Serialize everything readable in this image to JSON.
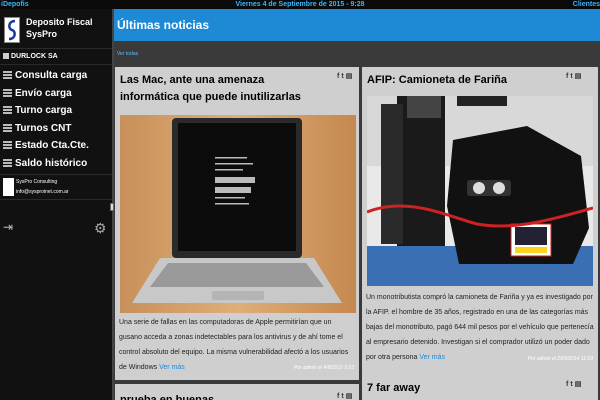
{
  "topbar": {
    "left": "iDepofis",
    "center": "Viernes 4 de Septiembre de 2015 - 9:28",
    "right": "Clientes"
  },
  "brand": {
    "line1": "Deposito Fiscal",
    "line2": "SysPro"
  },
  "company": "DURLOCK SA",
  "menu": [
    {
      "label": "Consulta carga"
    },
    {
      "label": "Envío carga"
    },
    {
      "label": "Turno carga"
    },
    {
      "label": "Turnos CNT"
    },
    {
      "label": "Estado Cta.Cte."
    },
    {
      "label": "Saldo histórico"
    }
  ],
  "consulting": {
    "name": "SysPro Consulting",
    "email": "info@sysproinet.com.ar"
  },
  "icons": {
    "exit": "exit-icon",
    "settings": "gear-icon",
    "share": [
      "facebook-icon",
      "twitter-icon",
      "share-icon"
    ]
  },
  "main": {
    "title": "Últimas noticias",
    "see_all": "Ver todas"
  },
  "articles": [
    {
      "title": "Las Mac, ante una amenaza informática que puede inutilizarlas",
      "body": "Una serie de fallas en las computadoras de Apple permitirían que un gusano acceda a zonas indetectables para los antivirus y de ahí tome el control absoluto del equipo. La misma vulnerabilidad afectó a los usuarios de Windows",
      "more": "Ver más",
      "meta": "Por admin el 4/8/2015 9:23"
    },
    {
      "title": "AFIP: Camioneta de Fariña",
      "body": "Un monotributista compró la camioneta de Fariña y ya es investigado por la AFIP. el hombre de 35 años, registrado en una de las categorías más bajas del monotributo, pagó 644 mil pesos por el vehículo que pertenecía al empresario detenido. Investigan si el comprador utilizó un poder dado por otra persona",
      "more": "Ver más",
      "meta": "Por admin el 29/9/2014 11:09"
    },
    {
      "title": "prueba en buenas"
    },
    {
      "title": "7 far away"
    }
  ],
  "colors": {
    "accent": "#1e8ad6",
    "topbar_text": "#38b6ff",
    "card": "#cfcfcf"
  }
}
